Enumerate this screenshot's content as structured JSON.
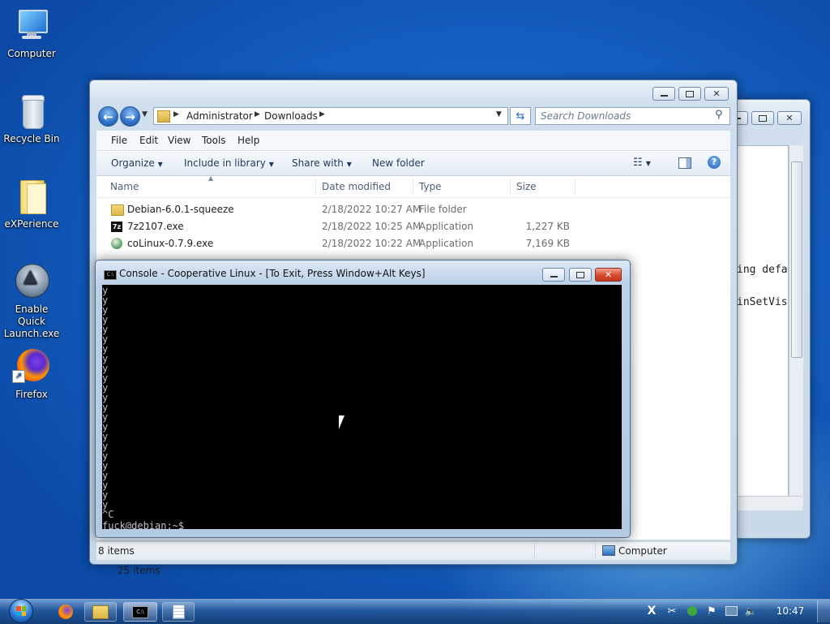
{
  "desktop": {
    "icons": [
      {
        "label": "Computer",
        "icon": "computer-icon"
      },
      {
        "label": "Recycle Bin",
        "icon": "recycle-bin-icon"
      },
      {
        "label": "eXPerience",
        "icon": "folder-icon"
      },
      {
        "label": "Enable Quick Launch.exe",
        "icon": "app-icon"
      },
      {
        "label": "Firefox",
        "icon": "firefox-icon"
      }
    ]
  },
  "explorer": {
    "address": {
      "crumbs": [
        "Administrator",
        "Downloads"
      ]
    },
    "search": {
      "placeholder": "Search Downloads"
    },
    "menu": [
      "File",
      "Edit",
      "View",
      "Tools",
      "Help"
    ],
    "toolbar": {
      "organize": "Organize",
      "include": "Include in library",
      "share": "Share with",
      "new_folder": "New folder"
    },
    "columns": {
      "name": "Name",
      "date": "Date modified",
      "type": "Type",
      "size": "Size"
    },
    "files": [
      {
        "name": "Debian-6.0.1-squeeze",
        "date": "2/18/2022 10:27 AM",
        "type": "File folder",
        "size": "",
        "icon": "folder-icon"
      },
      {
        "name": "7z2107.exe",
        "date": "2/18/2022 10:25 AM",
        "type": "Application",
        "size": "1,227 KB",
        "icon": "7zip-icon"
      },
      {
        "name": "coLinux-0.7.9.exe",
        "date": "2/18/2022 10:22 AM",
        "type": "Application",
        "size": "7,169 KB",
        "icon": "setup-icon"
      }
    ],
    "status": {
      "items": "8 items",
      "location": "Computer"
    }
  },
  "back_window": {
    "text_lines": [
      "ing defa",
      "inSetVis"
    ],
    "status": "25 items"
  },
  "console": {
    "title": "Console - Cooperative Linux - [To Exit, Press Window+Alt Keys]",
    "lines": [
      "y",
      "y",
      "y",
      "y",
      "y",
      "y",
      "y",
      "y",
      "y",
      "y",
      "y",
      "y",
      "y",
      "y",
      "y",
      "y",
      "y",
      "y",
      "y",
      "y",
      "y",
      "y",
      "y",
      "^C"
    ],
    "prompt": "fuck@debian:~$"
  },
  "taskbar": {
    "clock": "10:47",
    "buttons": [
      "firefox-icon",
      "explorer-icon",
      "console-icon",
      "notepad-icon"
    ]
  },
  "colors": {
    "accent": "#1f5fb8",
    "console_bg": "#000000",
    "console_fg": "#c0c0c0"
  }
}
